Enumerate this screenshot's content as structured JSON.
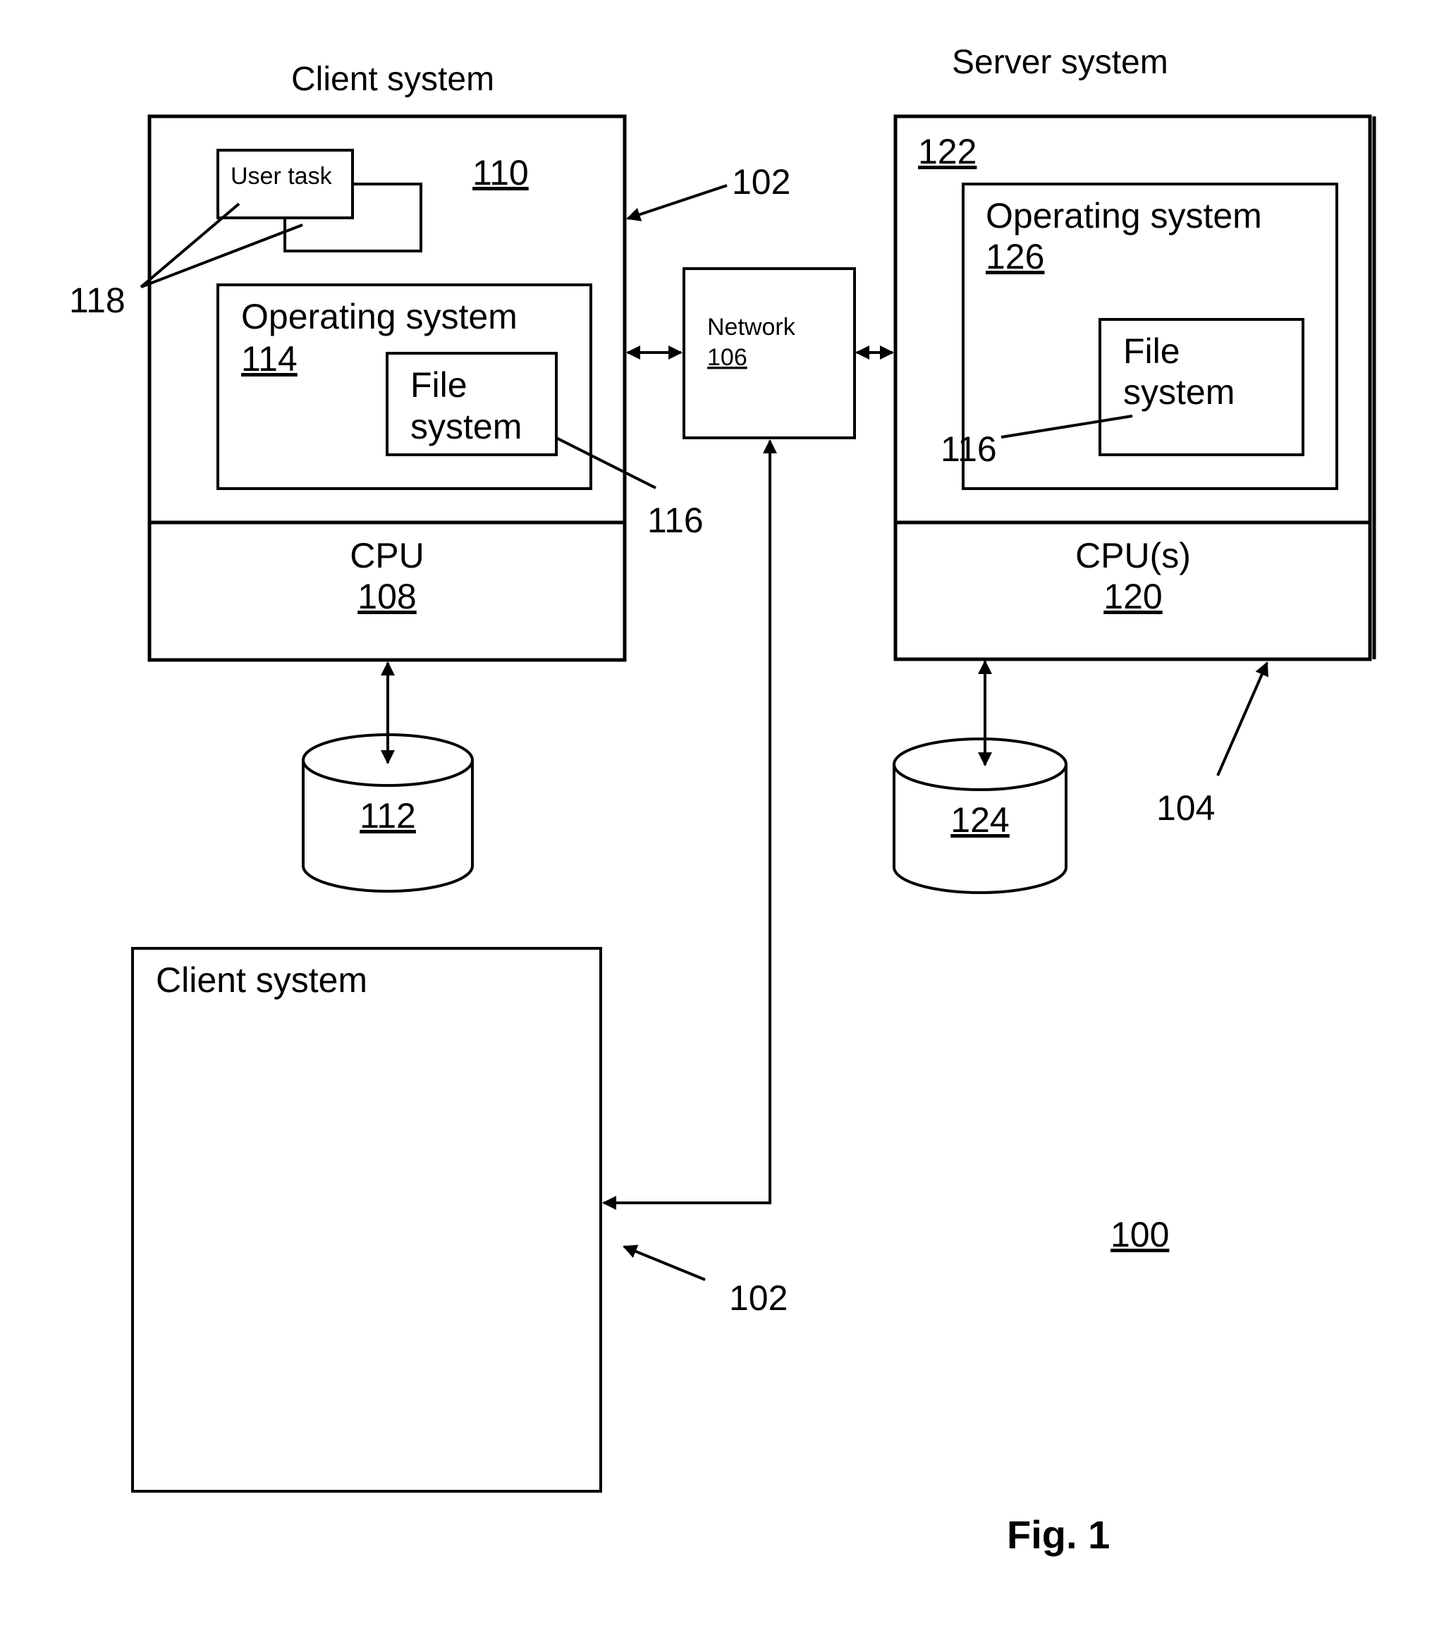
{
  "figure": {
    "caption": "Fig. 1",
    "system_ref": "100"
  },
  "client_system_1": {
    "title": "Client system",
    "ref_arrow_label": "102",
    "memory_ref": "110",
    "user_task": {
      "label": "User task",
      "ref": "118"
    },
    "operating_system": {
      "label": "Operating system",
      "ref": "114"
    },
    "file_system": {
      "line1": "File",
      "line2": "system",
      "ref": "116"
    },
    "cpu": {
      "label": "CPU",
      "ref": "108"
    },
    "storage_ref": "112"
  },
  "network": {
    "label": "Network",
    "ref": "106"
  },
  "server_system": {
    "title": "Server system",
    "ref_arrow_label": "104",
    "memory_ref": "122",
    "operating_system": {
      "label": "Operating system",
      "ref": "126"
    },
    "file_system": {
      "line1": "File",
      "line2": "system",
      "ref": "116"
    },
    "cpu": {
      "label": "CPU(s)",
      "ref": "120"
    },
    "storage_ref": "124"
  },
  "client_system_2": {
    "title": "Client system",
    "ref_arrow_label": "102"
  }
}
